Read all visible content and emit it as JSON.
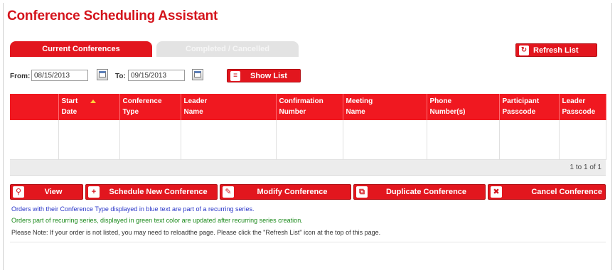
{
  "title": "Conference Scheduling Assistant",
  "tabs": [
    {
      "label": "Current Conferences",
      "active": true
    },
    {
      "label": "Completed / Cancelled",
      "active": false
    }
  ],
  "refresh_button": {
    "label": "Refresh List",
    "icon": "refresh-icon"
  },
  "date_filter": {
    "from_label": "From:",
    "from_value": "08/15/2013",
    "to_label": "To:",
    "to_value": "09/15/2013",
    "show_list_label": "Show List"
  },
  "table": {
    "columns": [
      {
        "line1": "",
        "line2": ""
      },
      {
        "line1": "Start",
        "line2": "Date",
        "sorted": "asc"
      },
      {
        "line1": "Conference",
        "line2": "Type"
      },
      {
        "line1": "Leader",
        "line2": "Name"
      },
      {
        "line1": "Confirmation",
        "line2": "Number"
      },
      {
        "line1": "Meeting",
        "line2": "Name"
      },
      {
        "line1": "Phone",
        "line2": "Number(s)"
      },
      {
        "line1": "Participant",
        "line2": "Passcode"
      },
      {
        "line1": "Leader",
        "line2": "Passcode"
      }
    ],
    "rows": [],
    "pager_text": "1 to 1 of 1"
  },
  "actions": [
    {
      "label": "View",
      "icon": "search-icon"
    },
    {
      "label": "Schedule New Conference",
      "icon": "plus-icon"
    },
    {
      "label": "Modify Conference",
      "icon": "edit-icon"
    },
    {
      "label": "Duplicate Conference",
      "icon": "duplicate-icon"
    },
    {
      "label": "Cancel Conference",
      "icon": "close-icon"
    }
  ],
  "notes": {
    "blue": "Orders with their Conference Type displayed in blue text are part of a recurring series.",
    "green": "Orders part of recurring series, displayed in green text color are updated after recurring series creation.",
    "black": "Please Note: If your order is not listed, you may need to reloadthe page. Please click the \"Refresh List\" icon at the top of this page."
  },
  "colors": {
    "brand_red": "#e2161e",
    "header_red": "#f01820",
    "note_blue": "#2a36c8",
    "note_green": "#1c8a1c"
  }
}
